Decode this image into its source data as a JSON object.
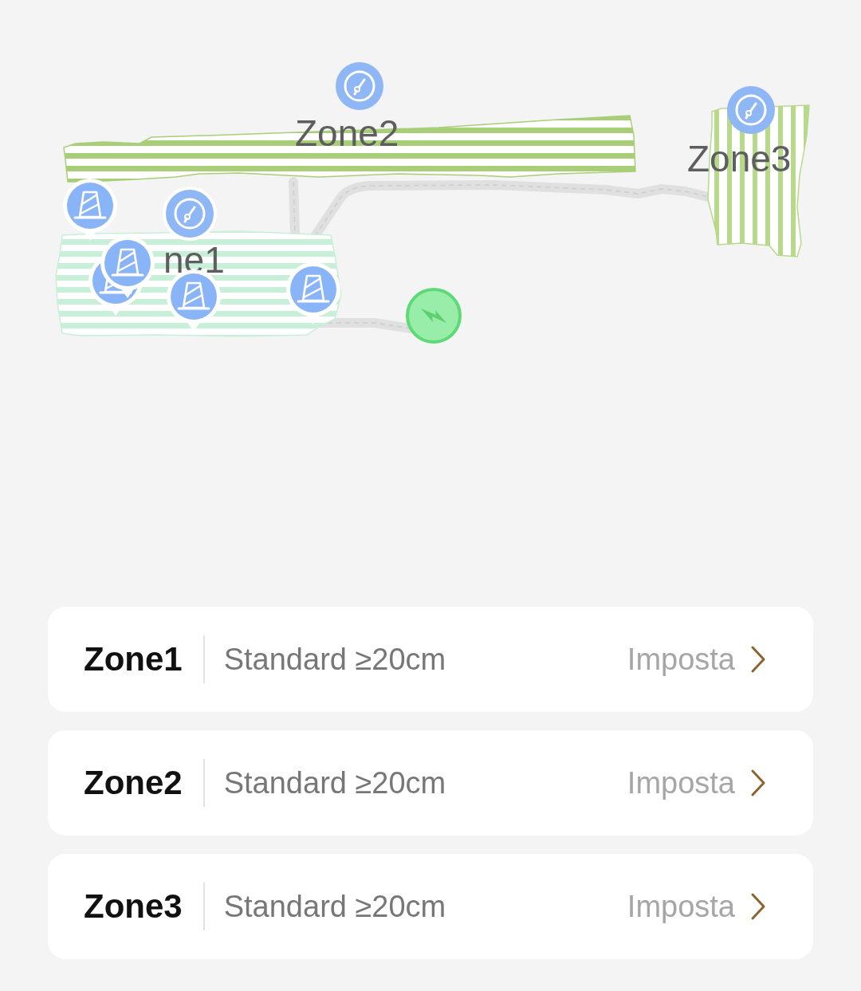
{
  "map": {
    "zones": [
      {
        "label": "ne1",
        "color": "#c8f0d8",
        "kind": "horizontal"
      },
      {
        "label": "Zone2",
        "color": "#a8cf78",
        "kind": "horizontal"
      },
      {
        "label": "Zone3",
        "color": "#b8d98c",
        "kind": "vertical"
      }
    ]
  },
  "zone_list": [
    {
      "name": "Zone1",
      "setting": "Standard ≥20cm",
      "action": "Imposta"
    },
    {
      "name": "Zone2",
      "setting": "Standard ≥20cm",
      "action": "Imposta"
    },
    {
      "name": "Zone3",
      "setting": "Standard ≥20cm",
      "action": "Imposta"
    }
  ]
}
